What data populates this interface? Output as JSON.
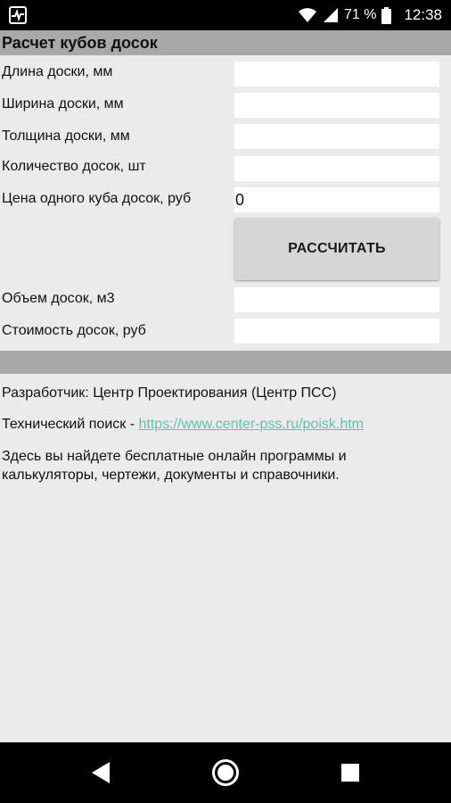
{
  "status_bar": {
    "battery_percent": "71 %",
    "time": "12:38",
    "icons": [
      "activity-icon",
      "wifi-icon",
      "cell-signal-icon",
      "battery-icon"
    ]
  },
  "header": {
    "title": "Расчет кубов досок"
  },
  "form": {
    "fields": [
      {
        "label": "Длина доски, мм",
        "value": ""
      },
      {
        "label": "Ширина доски, мм",
        "value": ""
      },
      {
        "label": "Толщина доски, мм",
        "value": ""
      },
      {
        "label": "Количество досок, шт",
        "value": ""
      },
      {
        "label": "Цена одного куба досок, руб",
        "value": "0"
      }
    ],
    "calc_button_label": "РАССЧИТАТЬ",
    "results": [
      {
        "label": "Объем досок, м3",
        "value": ""
      },
      {
        "label": "Стоимость досок, руб",
        "value": ""
      }
    ]
  },
  "info": {
    "developer": "Разработчик: Центр Проектирования (Центр ПСС)",
    "search_prefix": "Технический поиск - ",
    "search_link": "https://www.center-pss.ru/poisk.htm",
    "description_line1": "Здесь вы найдете бесплатные онлайн программы и",
    "description_line2": "калькуляторы, чертежи, документы и справочники."
  },
  "colors": {
    "background": "#ebebeb",
    "header_bar": "#a9a9a9",
    "link": "#5fbfb0",
    "button": "#d6d6d6"
  },
  "nav_bar": {
    "icons": [
      "back-icon",
      "home-icon",
      "recents-icon"
    ]
  }
}
